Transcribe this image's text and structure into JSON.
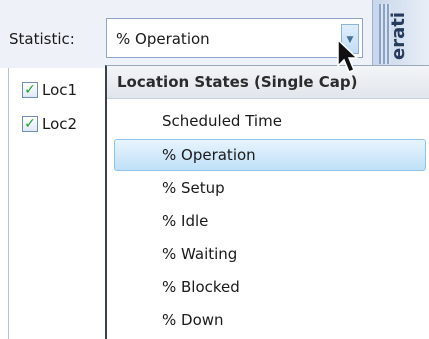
{
  "statistic": {
    "label": "Statistic:",
    "selected_value": "% Operation"
  },
  "side_panel": {
    "vertical_text": "erati"
  },
  "locations": [
    {
      "label": "Loc1",
      "checked": true
    },
    {
      "label": "Loc2",
      "checked": true
    }
  ],
  "dropdown": {
    "group_header": "Location States (Single Cap)",
    "options": [
      "Scheduled Time",
      "% Operation",
      "% Setup",
      "% Idle",
      "% Waiting",
      "% Blocked",
      "% Down"
    ],
    "selected_index": 1
  },
  "colors": {
    "selection_fill": "#bfe0f8",
    "check_green": "#22a02a",
    "panel_bg": "#eef2f8"
  },
  "icons": {
    "combo_arrow": "chevron-down-icon",
    "cursor": "mouse-pointer-icon",
    "check": "checkmark-icon"
  }
}
